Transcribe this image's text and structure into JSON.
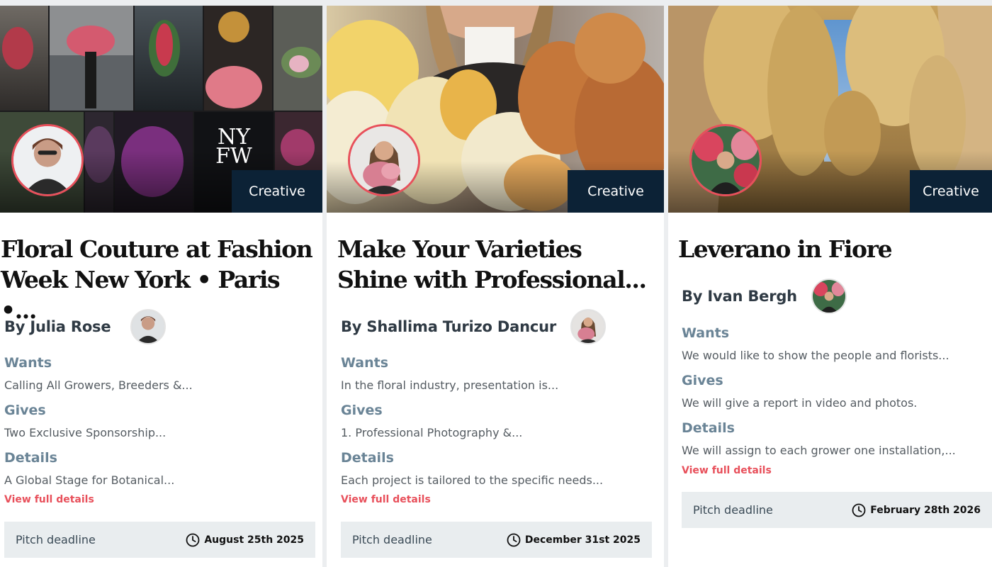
{
  "cards": [
    {
      "tag": "Creative",
      "title_line1": "Floral Couture at Fashion",
      "title_line2": "Week New York • Paris •...",
      "byline": "By Julia Rose",
      "wants_label": "Wants",
      "wants": "Calling All Growers, Breeders &...",
      "gives_label": "Gives",
      "gives": "Two Exclusive Sponsorship...",
      "details_label": "Details",
      "details": "A Global Stage for Botanical...",
      "link": "View full details",
      "deadline_label": "Pitch deadline",
      "deadline": "August 25th 2025",
      "logo_line1": "NY",
      "logo_line2": "FW"
    },
    {
      "tag": "Creative",
      "title_line1": "Make Your Varieties",
      "title_line2": "Shine with Professional...",
      "byline": "By Shallima Turizo Dancur",
      "wants_label": "Wants",
      "wants": "In the floral industry, presentation is...",
      "gives_label": "Gives",
      "gives": "1. Professional Photography &...",
      "details_label": "Details",
      "details": "Each project is tailored to the specific needs...",
      "link": "View full details",
      "deadline_label": "Pitch deadline",
      "deadline": "December 31st 2025"
    },
    {
      "tag": "Creative",
      "title_line1": "Leverano in Fiore",
      "byline": "By Ivan Bergh",
      "wants_label": "Wants",
      "wants": "We would like to show the people and florists...",
      "gives_label": "Gives",
      "gives": "We will give a report in video and photos.",
      "details_label": "Details",
      "details": "We will assign to each grower one installation,...",
      "link": "View full details",
      "deadline_label": "Pitch deadline",
      "deadline": "February 28th 2026"
    }
  ],
  "colors": {
    "accent": "#e8505b",
    "tag_bg": "#0c2236",
    "label": "#6a8496",
    "deadline_bg": "#e9edef"
  },
  "icons": [
    "clock-icon",
    "avatar",
    "hero-image"
  ]
}
